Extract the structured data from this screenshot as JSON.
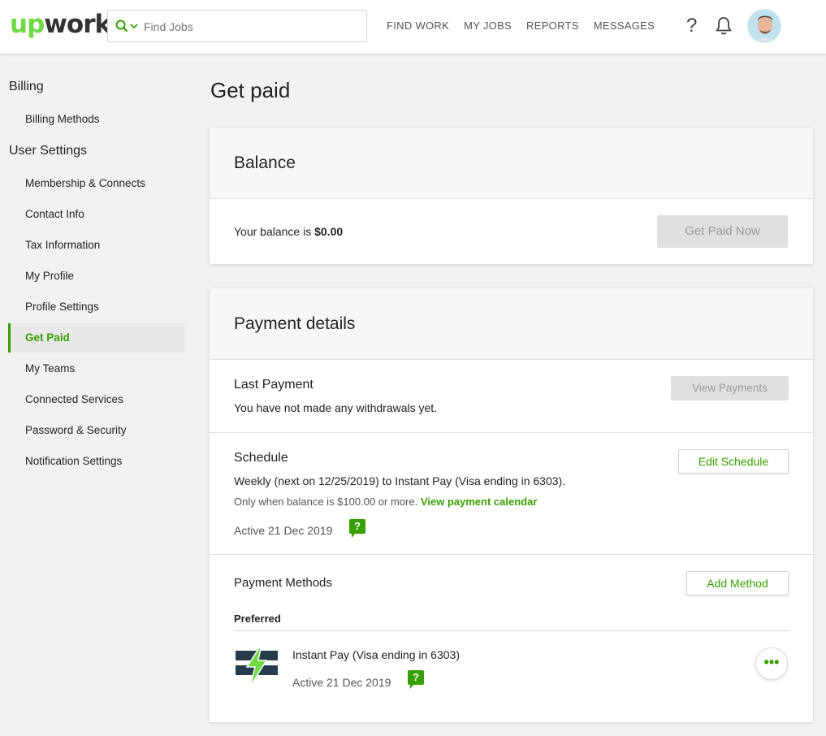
{
  "header": {
    "logo_up": "Up",
    "logo_work": "work",
    "search_placeholder": "Find Jobs",
    "nav": [
      "FIND WORK",
      "MY JOBS",
      "REPORTS",
      "MESSAGES"
    ],
    "help": "?"
  },
  "sidebar": {
    "billing_heading": "Billing",
    "billing_items": [
      "Billing Methods"
    ],
    "settings_heading": "User Settings",
    "settings_items": [
      "Membership & Connects",
      "Contact Info",
      "Tax Information",
      "My Profile",
      "Profile Settings",
      "Get Paid",
      "My Teams",
      "Connected Services",
      "Password & Security",
      "Notification Settings"
    ],
    "active": "Get Paid"
  },
  "page": {
    "title": "Get paid"
  },
  "balance": {
    "heading": "Balance",
    "text_prefix": "Your balance is",
    "amount": "$0.00",
    "button": "Get Paid Now"
  },
  "payment_details": {
    "heading": "Payment details",
    "last_payment": {
      "title": "Last Payment",
      "text": "You have not made any withdrawals yet.",
      "button": "View Payments"
    },
    "schedule": {
      "title": "Schedule",
      "text": "Weekly (next on 12/25/2019) to Instant Pay (Visa ending in 6303).",
      "condition": "Only when balance is $100.00 or more.",
      "calendar_link": "View payment calendar",
      "status": "Active 21 Dec 2019",
      "button": "Edit Schedule"
    },
    "methods": {
      "title": "Payment Methods",
      "button": "Add Method",
      "preferred_label": "Preferred",
      "method_name": "Instant Pay (Visa ending in 6303)",
      "method_status": "Active 21 Dec 2019",
      "more": "•••"
    }
  },
  "colors": {
    "brand_green": "#37a000",
    "logo_green": "#6fda44",
    "background": "#f2f2f2"
  }
}
